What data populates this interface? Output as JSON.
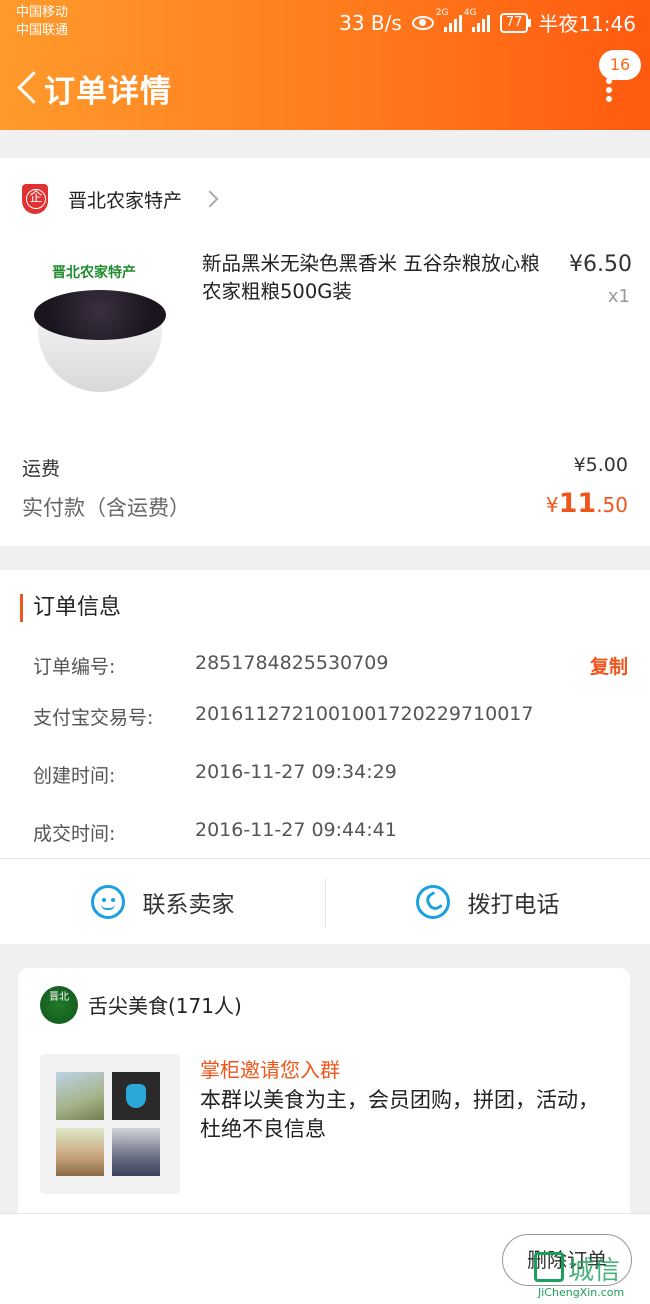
{
  "status_bar": {
    "carrier1": "中国移动",
    "carrier2": "中国联通",
    "speed": "33 B/s",
    "net1": "2G",
    "net2": "4G",
    "battery": "77",
    "time": "半夜11:46"
  },
  "header": {
    "title": "订单详情",
    "badge": "16"
  },
  "shop": {
    "name": "晋北农家特产"
  },
  "product": {
    "image_brand": "晋北农家特产",
    "title": "新品黑米无染色黑香米 五谷杂粮放心粮农家粗粮500G装",
    "price": "¥6.50",
    "qty": "x1"
  },
  "summary": {
    "shipping_label": "运费",
    "shipping_value": "¥5.00",
    "paid_label": "实付款（含运费）",
    "paid_currency": "¥",
    "paid_int": "11",
    "paid_dec": ".50"
  },
  "order_info": {
    "title": "订单信息",
    "copy_label": "复制",
    "rows": [
      {
        "label": "订单编号:",
        "value": "2851784825530709"
      },
      {
        "label": "支付宝交易号:",
        "value": "2016112721001001720229710017"
      },
      {
        "label": "创建时间:",
        "value": "2016-11-27 09:34:29"
      },
      {
        "label": "成交时间:",
        "value": "2016-11-27 09:44:41"
      }
    ],
    "contact_label": "联系卖家",
    "call_label": "拨打电话"
  },
  "group": {
    "logo_text": "晋北",
    "name": "舌尖美食(171人)",
    "invite_title": "掌柜邀请您入群",
    "invite_desc": "本群以美食为主，会员团购，拼团，活动，杜绝不良信息"
  },
  "bottom": {
    "delete_label": "删除订单"
  },
  "watermark": {
    "text": "城信",
    "sub": "JiChengXin.com"
  },
  "colors": {
    "accent": "#f0561c",
    "header_start": "#ff9a2c",
    "header_end": "#ff5a10",
    "icon_blue": "#1ba0e1"
  }
}
